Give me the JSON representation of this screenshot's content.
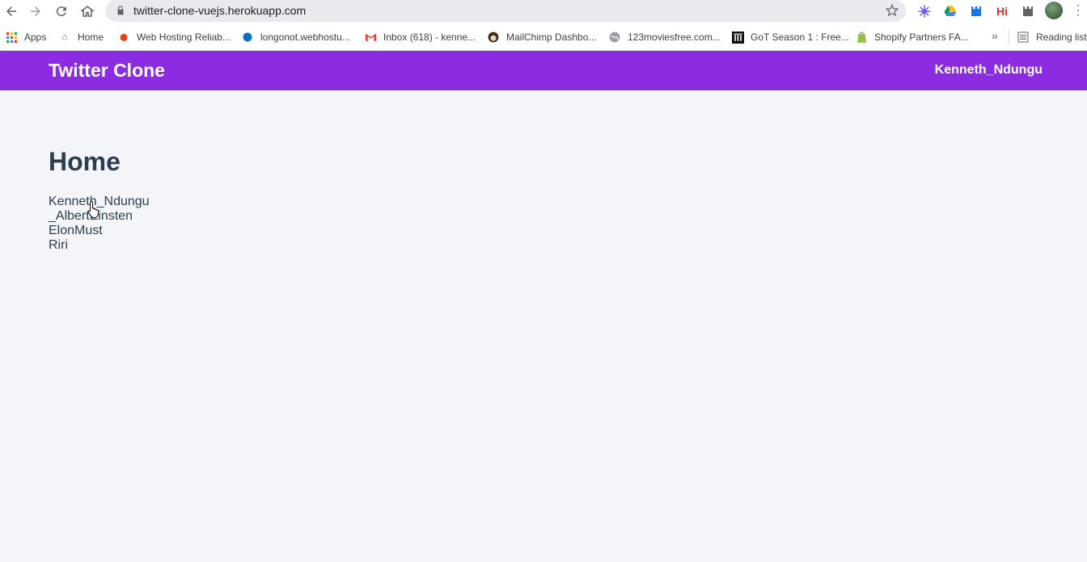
{
  "browser": {
    "url": "twitter-clone-vuejs.herokuapp.com",
    "bookmarks": [
      {
        "label": "Apps",
        "icon": "apps-grid-icon"
      },
      {
        "label": "Home",
        "icon": "home-bookmark-icon"
      },
      {
        "label": "Web Hosting Reliab...",
        "icon": "hosting-icon"
      },
      {
        "label": "longonot.webhostu...",
        "icon": "globe-blue-icon"
      },
      {
        "label": "Inbox (618) - kenne...",
        "icon": "gmail-icon"
      },
      {
        "label": "MailChimp Dashbo...",
        "icon": "mailchimp-icon"
      },
      {
        "label": "123moviesfree.com...",
        "icon": "globe-icon"
      },
      {
        "label": "GoT Season 1 : Free...",
        "icon": "archive-icon"
      },
      {
        "label": "Shopify Partners FA...",
        "icon": "shopify-icon"
      }
    ],
    "more_bookmarks": "»",
    "reading_list": "Reading list",
    "extensions": {
      "hi_label": "Hi"
    }
  },
  "app": {
    "brand": "Twitter Clone",
    "current_user": "Kenneth_Ndungu",
    "page_title": "Home",
    "users": [
      "Kenneth_Ndungu",
      "_AlbertEinsten",
      "ElonMust",
      "Riri"
    ]
  },
  "colors": {
    "header_bg": "#8b2be2",
    "page_bg": "#f3f5f9",
    "text": "#2c3e50"
  }
}
